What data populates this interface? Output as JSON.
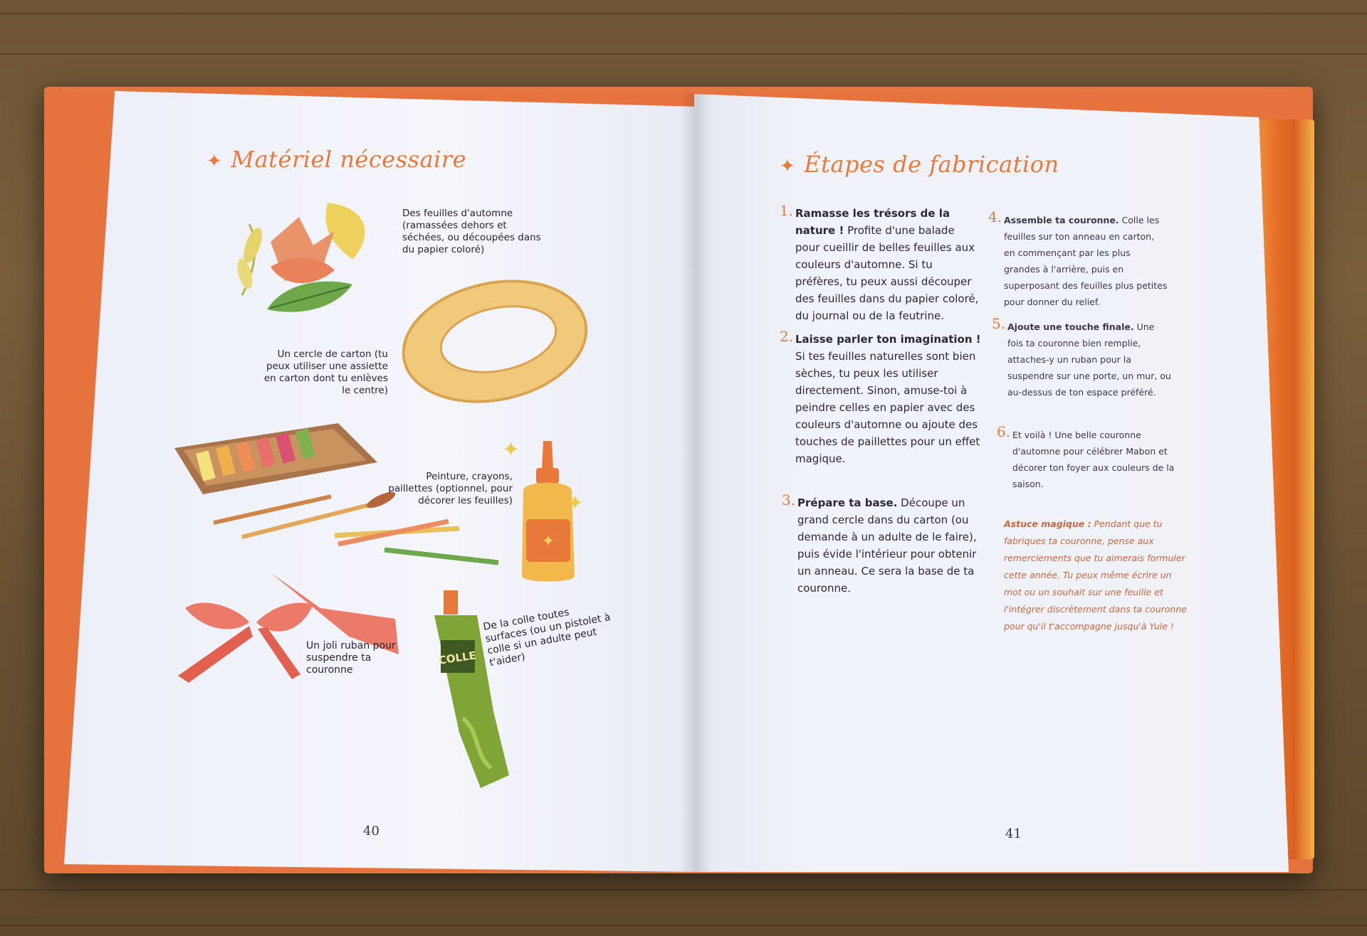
{
  "left_page": {
    "heading": "Matériel nécessaire",
    "captions": {
      "leaves": "Des feuilles d'automne (ramassées dehors et séchées, ou découpées dans du papier coloré)",
      "ring": "Un cercle de carton (tu peux utiliser une assiette en carton dont tu enlèves le centre)",
      "paint": "Peinture, crayons, paillettes (optionnel, pour décorer les feuilles)",
      "glue": "De la colle toutes surfaces (ou un pistolet à colle si un adulte peut t'aider)",
      "ribbon": "Un joli ruban pour suspendre ta couronne"
    },
    "glue_tube_label": "COLLE",
    "page_number": "40"
  },
  "right_page": {
    "heading": "Étapes de fabrication",
    "steps": [
      {
        "num": "1.",
        "title": "Ramasse les trésors de la nature !",
        "text": "Profite d'une balade pour cueillir de belles feuilles aux couleurs d'automne. Si tu préfères, tu peux aussi découper des feuilles dans du papier coloré, du journal ou de la feutrine."
      },
      {
        "num": "2.",
        "title": "Laisse parler ton imagination !",
        "text": "Si tes feuilles naturelles sont bien sèches, tu peux les utiliser directement. Sinon, amuse-toi à peindre celles en papier avec des couleurs d'automne ou ajoute des touches de paillettes pour un effet magique."
      },
      {
        "num": "3.",
        "title": "Prépare ta base.",
        "text": "Découpe un grand cercle dans du carton (ou demande à un adulte de le faire), puis évide l'intérieur pour obtenir un anneau. Ce sera la base de ta couronne."
      },
      {
        "num": "4.",
        "title": "Assemble ta couronne.",
        "text": "Colle les feuilles sur ton anneau en carton, en commençant par les plus grandes à l'arrière, puis en superposant des feuilles plus petites pour donner du relief."
      },
      {
        "num": "5.",
        "title": "Ajoute une touche finale.",
        "text": "Une fois ta couronne bien remplie, attaches-y un ruban pour la suspendre sur une porte, un mur, ou au-dessus de ton espace préféré."
      },
      {
        "num": "6.",
        "title": "",
        "text": "Et voilà ! Une belle couronne d'automne pour célébrer Mabon et décorer ton foyer aux couleurs de la saison."
      }
    ],
    "astuce_label": "Astuce magique :",
    "astuce_text": "Pendant que tu fabriques ta couronne, pense aux remerciements que tu aimerais formuler cette année. Tu peux même écrire un mot ou un souhait sur une feuille et l'intégrer discrètement dans ta couronne pour qu'il t'accompagne jusqu'à Yule !",
    "page_number": "41"
  },
  "colors": {
    "accent": "#e8793a",
    "cover": "#e6733e",
    "page": "#f1f3fa",
    "text": "#2b2a33"
  }
}
